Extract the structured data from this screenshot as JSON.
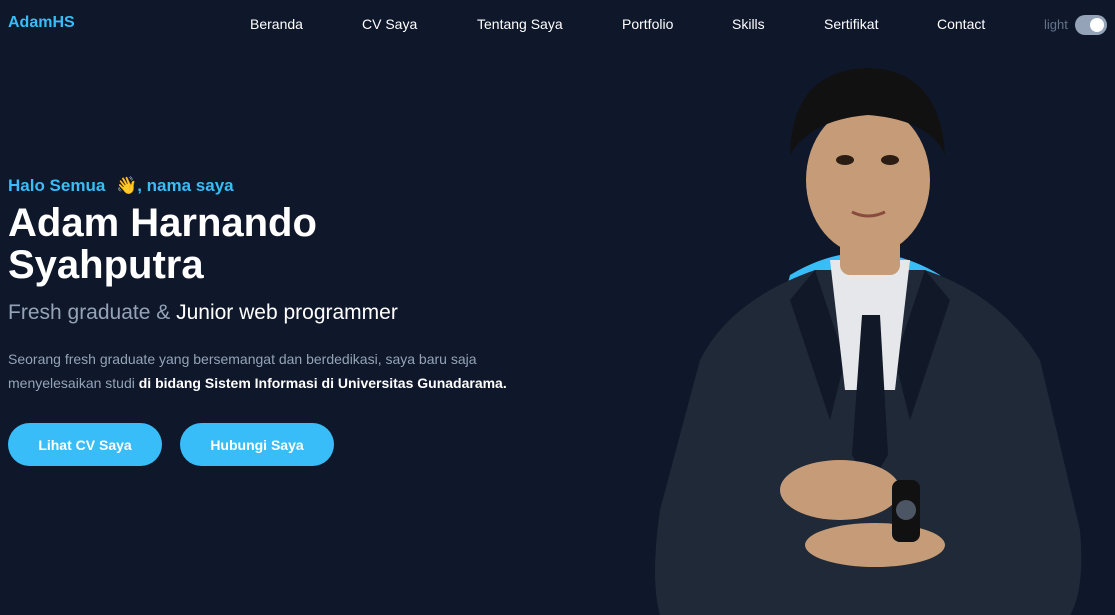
{
  "nav": {
    "brand": "AdamHS",
    "links": [
      "Beranda",
      "CV Saya",
      "Tentang Saya",
      "Portfolio",
      "Skills",
      "Sertifikat",
      "Contact"
    ],
    "theme_label": "light",
    "theme_toggle_on": true
  },
  "hero": {
    "greeting_prefix": "Halo Semua",
    "greeting_emoji": "👋",
    "greeting_suffix": ", nama saya",
    "name_line1": "Adam Harnando",
    "name_line2": "Syahputra",
    "role_plain": "Fresh graduate & ",
    "role_highlight": "Junior web programmer",
    "description_plain": "Seorang fresh graduate yang bersemangat dan berdedikasi, saya baru saja menyelesaikan studi ",
    "description_highlight": "di bidang Sistem Informasi di Universitas Gunadarama.",
    "cv_button": "Lihat CV Saya",
    "contact_button": "Hubungi Saya"
  },
  "colors": {
    "background": "#0f172a",
    "accent": "#38bdf8",
    "muted_text": "#94a3b8"
  }
}
